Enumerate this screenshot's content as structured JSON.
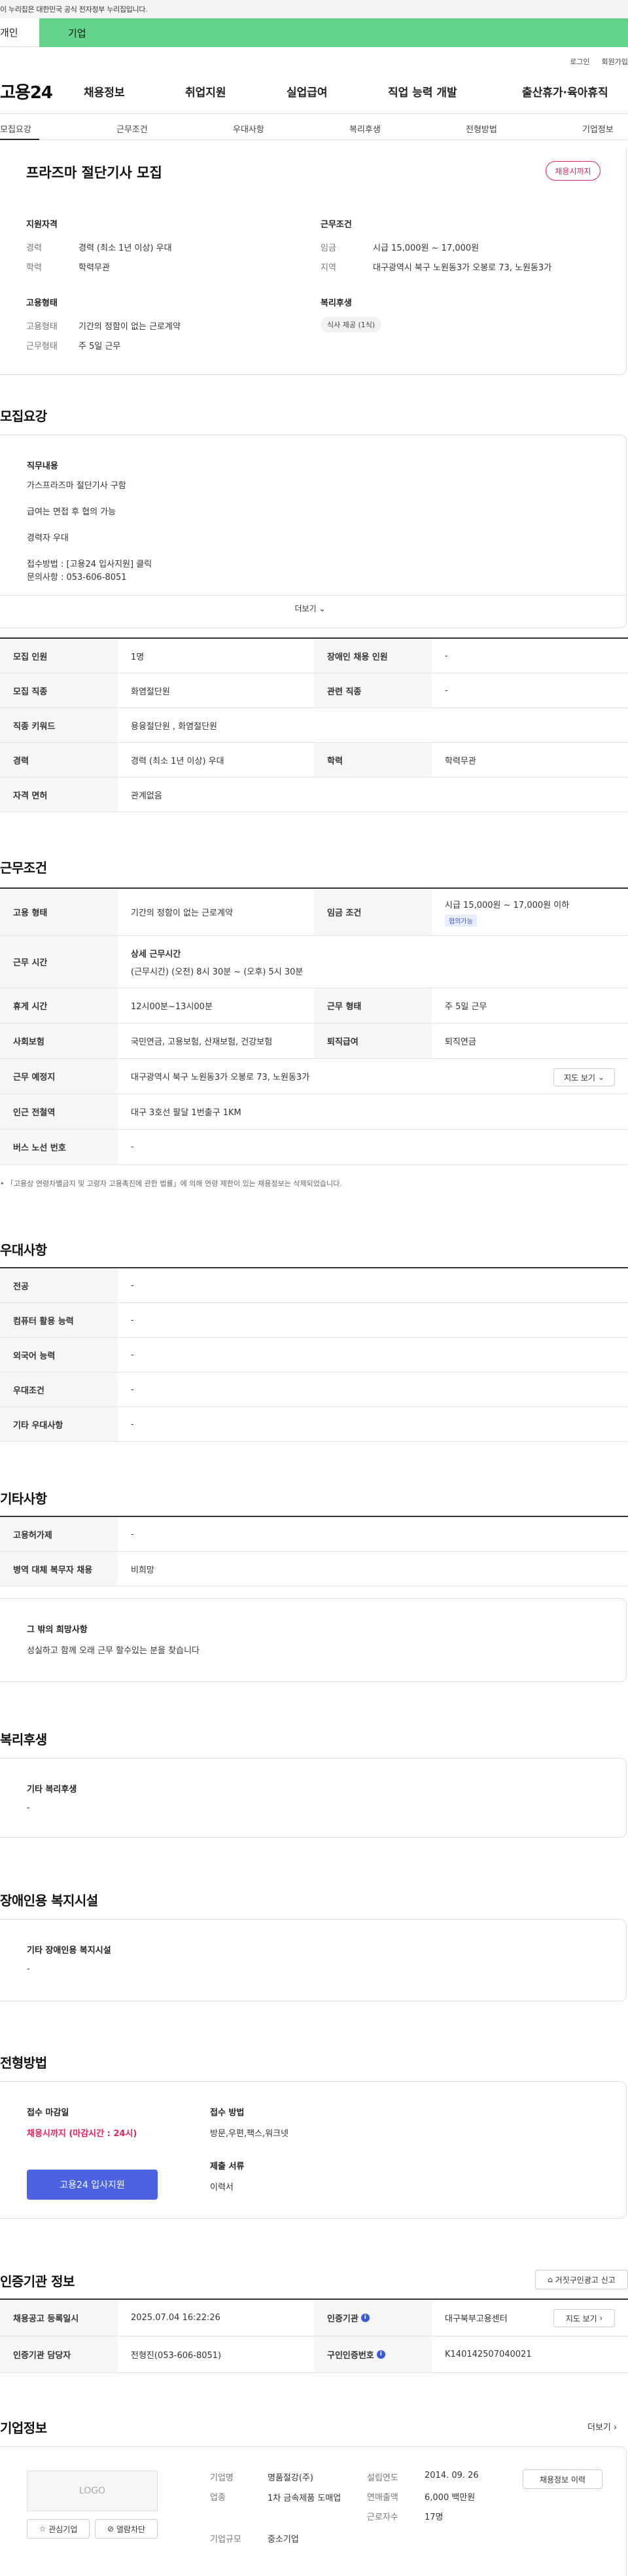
{
  "gov_banner": "이 누리집은 대한민국 공식 전자정부 누리집입니다.",
  "user_tabs": [
    "개인",
    "기업"
  ],
  "util": [
    "로그인",
    "회원가입"
  ],
  "logo": "고용24",
  "gnb": [
    "채용정보",
    "취업지원",
    "실업급여",
    "직업 능력 개발",
    "출산휴가·육아휴직"
  ],
  "subnav": [
    "모집요강",
    "근무조건",
    "우대사항",
    "복리후생",
    "전형방법",
    "기업정보"
  ],
  "job": {
    "title": "프라즈마 절단기사 모집",
    "badge": "채용시까지",
    "qual_h": "지원자격",
    "cond_h": "근무조건",
    "emp_h": "고용형태",
    "welfare_h": "복리후생",
    "career_k": "경력",
    "career_v": "경력 (최소 1년 이상) 우대",
    "edu_k": "학력",
    "edu_v": "학력무관",
    "wage_k": "임금",
    "wage_v": "시급 15,000원 ~ 17,000원",
    "area_k": "지역",
    "area_v": "대구광역시 북구 노원동3가 오봉로 73, 노원동3가",
    "emptype_k": "고용형태",
    "emptype_v": "기간의 정함이 없는 근로계약",
    "worktype_k": "근무형태",
    "worktype_v": "주 5일 근무",
    "welfare_pill": "식사 제공 (1식)"
  },
  "recruit": {
    "h": "모집요강",
    "duty_h": "직무내용",
    "lines": [
      "가스프라즈마 절단기사 구함",
      "급여는 면접 후 협의 가능",
      "경력자 우대",
      "접수방법 : [고용24 입사지원] 클릭",
      "문의사항 : 053-606-8051"
    ],
    "more": "더보기",
    "rows": [
      {
        "k1": "모집 인원",
        "v1": "1명",
        "k2": "장애인 채용 인원",
        "v2": "-"
      },
      {
        "k1": "모집 직종",
        "v1": "화염절단원",
        "k2": "관련 직종",
        "v2": "-"
      },
      {
        "k1": "직종 키워드",
        "v1": "용융절단원 , 화염절단원"
      },
      {
        "k1": "경력",
        "v1": "경력 (최소 1년 이상) 우대",
        "k2": "학력",
        "v2": "학력무관"
      },
      {
        "k1": "자격 면허",
        "v1": "관계없음"
      }
    ]
  },
  "work": {
    "h": "근무조건",
    "emptype_k": "고용 형태",
    "emptype_v": "기간의 정함이 없는 근로계약",
    "wage_k": "임금 조건",
    "wage_v": "시급 15,000원 ~ 17,000원 이하",
    "wage_tag": "협의가능",
    "time_k": "근무 시간",
    "time_h": "상세 근무시간",
    "time_v": "(근무시간) (오전) 8시 30분 ~ (오후) 5시 30분",
    "rest_k": "휴게 시간",
    "rest_v": "12시00분~13시00분",
    "form_k": "근무 형태",
    "form_v": "주 5일 근무",
    "ins_k": "사회보험",
    "ins_v": "국민연금, 고용보험, 산재보험, 건강보험",
    "ret_k": "퇴직급여",
    "ret_v": "퇴직연금",
    "place_k": "근무 예정지",
    "place_v": "대구광역시 북구 노원동3가 오봉로 73, 노원동3가",
    "map_btn": "지도 보기",
    "subway_k": "인근 전철역",
    "subway_v": "대구 3호선 팔달 1번출구 1KM",
    "bus_k": "버스 노선 번호",
    "bus_v": "-",
    "note": "「고용상 연령차별금지 및 고령자 고용촉진에 관한 법률」에 의해 연령 제한이 있는 채용정보는 삭제되었습니다."
  },
  "pref": {
    "h": "우대사항",
    "rows": [
      [
        "전공",
        "-"
      ],
      [
        "컴퓨터 활용 능력",
        "-"
      ],
      [
        "외국어 능력",
        "-"
      ],
      [
        "우대조건",
        "-"
      ],
      [
        "기타 우대사항",
        "-"
      ]
    ]
  },
  "etc": {
    "h": "기타사항",
    "rows": [
      [
        "고용허가제",
        "-"
      ],
      [
        "병역 대체 복무자 채용",
        "비희망"
      ]
    ],
    "wish_h": "그 밖의 희망사항",
    "wish_v": "성실하고 함께 오래 근무 할수있는 분을 찾습니다"
  },
  "welfare": {
    "h": "복리후생",
    "sub": "기타 복리후생",
    "v": "-"
  },
  "disabled": {
    "h": "장애인용 복지시설",
    "sub": "기타 장애인용 복지시설",
    "v": "-"
  },
  "process": {
    "h": "전형방법",
    "deadline_h": "접수 마감일",
    "deadline_v": "채용시까지 (마감시간 : 24시)",
    "method_h": "접수 방법",
    "method_v": "방문,우편,팩스,워크넷",
    "docs_h": "제출 서류",
    "docs_v": "이력서",
    "apply": "고용24 입사지원"
  },
  "agency": {
    "h": "인증기관 정보",
    "report": "거짓구인광고 신고",
    "reg_k": "채용공고 등록일시",
    "reg_v": "2025.07.04 16:22:26",
    "org_k": "인증기관",
    "org_v": "대구북부고용센터",
    "map_btn": "지도 보기",
    "mgr_k": "인증기관 담당자",
    "mgr_v": "전형진(053-606-8051)",
    "no_k": "구인인증번호",
    "no_v": "K140142507040021"
  },
  "company": {
    "h": "기업정보",
    "more": "더보기",
    "logo": "LOGO",
    "fav": "관심기업",
    "block": "열람차단",
    "name_k": "기업명",
    "name_v": "명품절강(주)",
    "ind_k": "업종",
    "ind_v": "1차 금속제품 도매업",
    "size_k": "기업규모",
    "size_v": "중소기업",
    "est_k": "설립연도",
    "est_v": "2014. 09. 26",
    "sales_k": "연매출액",
    "sales_v": "6,000 백만원",
    "emp_k": "근로자수",
    "emp_v": "17명",
    "history_btn": "채용정보 이력"
  }
}
